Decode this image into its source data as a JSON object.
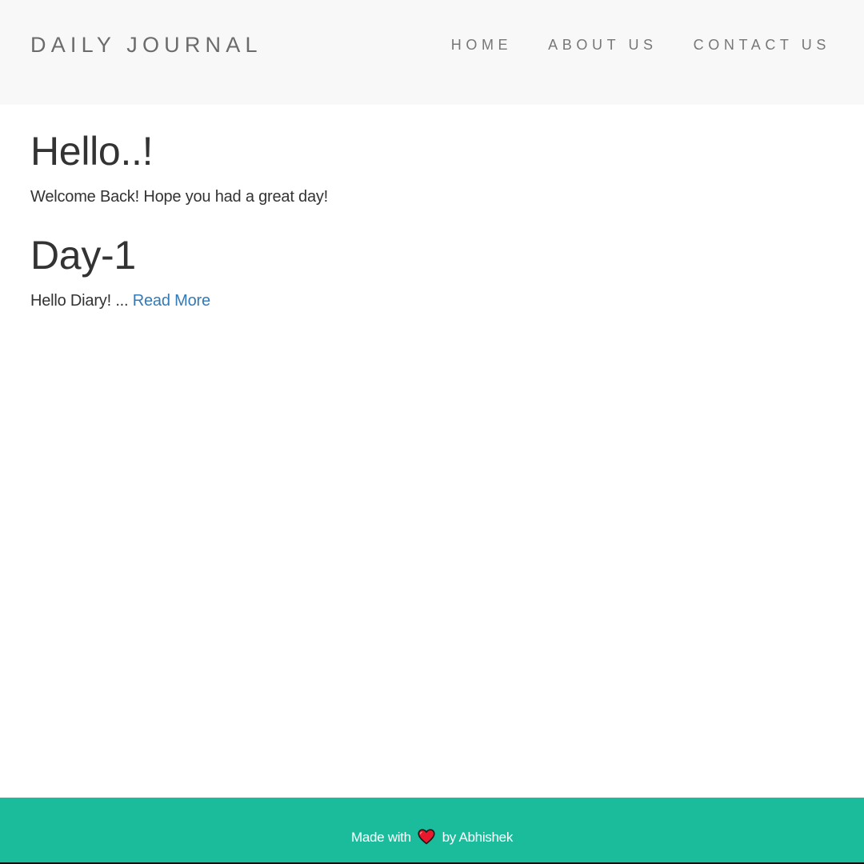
{
  "navbar": {
    "brand": "DAILY JOURNAL",
    "links": [
      {
        "label": "HOME"
      },
      {
        "label": "ABOUT US"
      },
      {
        "label": "CONTACT US"
      }
    ]
  },
  "home": {
    "heading": "Hello..!",
    "welcome": "Welcome Back! Hope you had a great day!"
  },
  "posts": [
    {
      "title": "Day-1",
      "excerpt": "Hello Diary! ...",
      "read_more_label": "Read More"
    }
  ],
  "footer": {
    "made_with": "Made with",
    "heart_icon": "heart-icon",
    "by_author": "by Abhishek"
  },
  "colors": {
    "navbar_bg": "#f8f8f8",
    "footer_bg": "#1abc9c",
    "link": "#337ab7",
    "heart": "#e8192c"
  }
}
